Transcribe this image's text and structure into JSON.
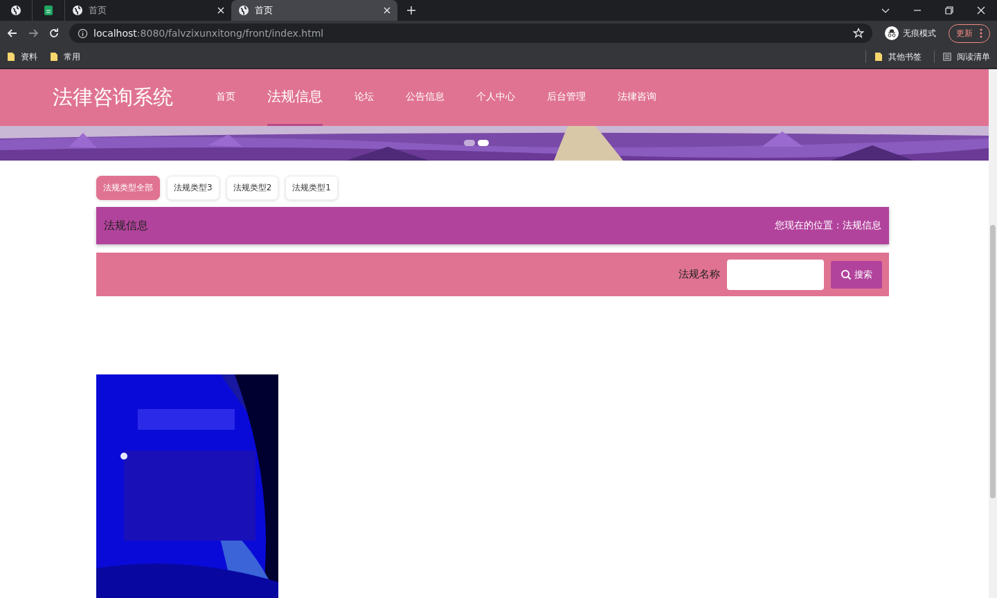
{
  "browser": {
    "tabs": [
      {
        "kind": "pinned",
        "selected": false
      },
      {
        "kind": "app",
        "selected": false
      },
      {
        "kind": "page",
        "title": "首页",
        "selected": false
      },
      {
        "kind": "page",
        "title": "首页",
        "selected": true
      }
    ],
    "url": {
      "host": "localhost",
      "path": ":8080/falvzixunxitong/front/index.html"
    },
    "incognito": "无痕模式",
    "update": "更新",
    "bookmarks": [
      "资料",
      "常用"
    ],
    "bookmarks_right": [
      {
        "kind": "folder",
        "label": "其他书签"
      },
      {
        "kind": "list",
        "label": "阅读清单"
      }
    ]
  },
  "site": {
    "logo": "法律咨询系统",
    "nav": [
      {
        "label": "首页",
        "selected": false
      },
      {
        "label": "法规信息",
        "selected": true
      },
      {
        "label": "论坛",
        "selected": false
      },
      {
        "label": "公告信息",
        "selected": false
      },
      {
        "label": "个人中心",
        "selected": false
      },
      {
        "label": "后台管理",
        "selected": false
      },
      {
        "label": "法律咨询",
        "selected": false
      }
    ],
    "banner": {
      "kind": "picture",
      "dots": [
        {
          "selected": false
        },
        {
          "selected": true
        }
      ]
    },
    "filters": [
      {
        "label": "法规类型全部",
        "selected": true
      },
      {
        "label": "法规类型3",
        "selected": false
      },
      {
        "label": "法规类型2",
        "selected": false
      },
      {
        "label": "法规类型1",
        "selected": false
      }
    ],
    "section_title": "法规信息",
    "breadcrumb": "您现在的位置：法规信息",
    "search": {
      "label": "法规名称",
      "button": "搜索"
    }
  }
}
